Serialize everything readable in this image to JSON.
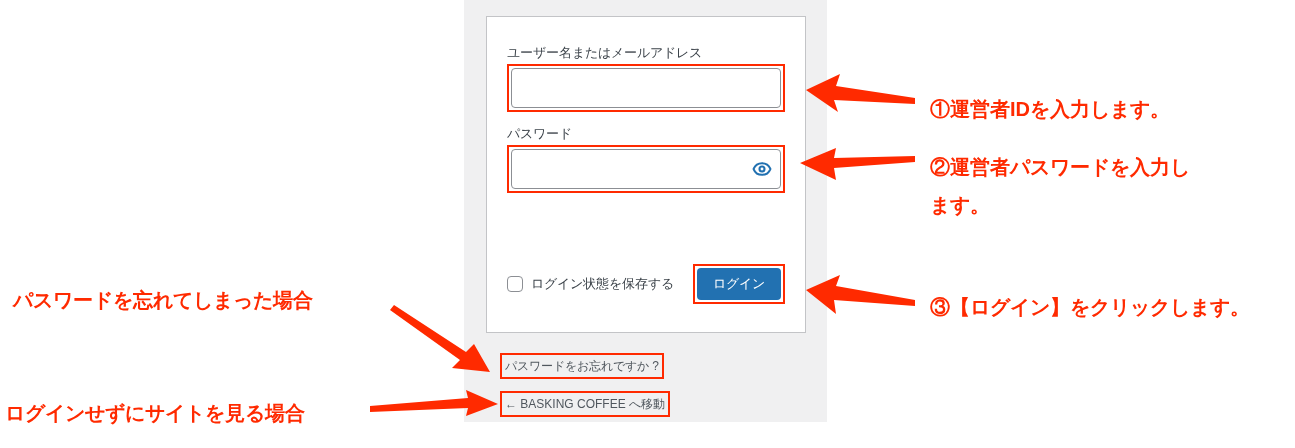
{
  "form": {
    "username": {
      "label": "ユーザー名またはメールアドレス",
      "highlighted": true
    },
    "password": {
      "label": "パスワード",
      "highlighted": true
    },
    "remember": {
      "label": "ログイン状態を保存する",
      "checked": false
    },
    "login_button": {
      "label": "ログイン",
      "highlighted": true
    }
  },
  "links": [
    {
      "text": "パスワードをお忘れですか ?",
      "highlighted": true
    },
    {
      "text": "← BASKING COFFEE へ移動",
      "highlighted": true
    }
  ],
  "callouts": [
    {
      "text": "①運営者IDを入力します。"
    },
    {
      "text": "②運営者パスワードを入力します。"
    },
    {
      "text": "パスワードを忘れてしまった場合"
    },
    {
      "text": "③【ログイン】をクリックします。"
    },
    {
      "text": "ログインせずにサイトを見る場合"
    }
  ]
}
